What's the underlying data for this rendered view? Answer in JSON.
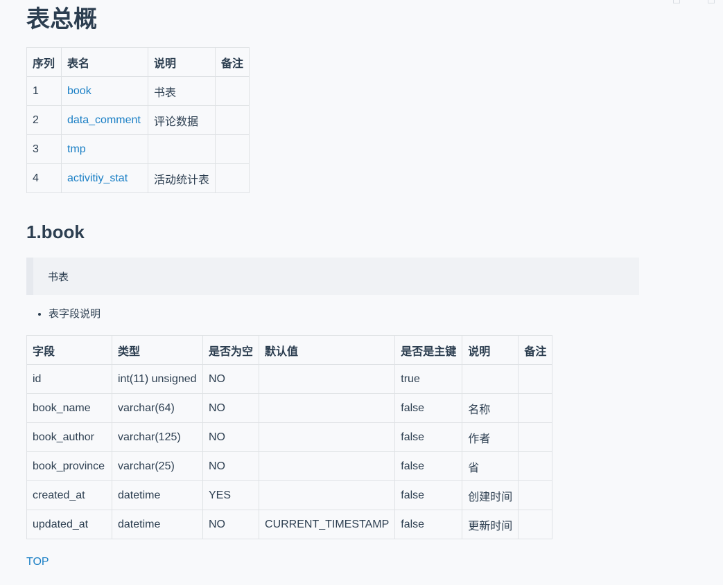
{
  "page_title": "表总概",
  "overview": {
    "headers": [
      "序列",
      "表名",
      "说明",
      "备注"
    ],
    "rows": [
      {
        "seq": "1",
        "name": "book",
        "desc": "书表",
        "note": ""
      },
      {
        "seq": "2",
        "name": "data_comment",
        "desc": "评论数据",
        "note": ""
      },
      {
        "seq": "3",
        "name": "tmp",
        "desc": "",
        "note": ""
      },
      {
        "seq": "4",
        "name": "activitiy_stat",
        "desc": "活动统计表",
        "note": ""
      }
    ]
  },
  "section": {
    "title": "1.book",
    "quote": "书表",
    "bullet": "表字段说明"
  },
  "fields": {
    "headers": [
      "字段",
      "类型",
      "是否为空",
      "默认值",
      "是否是主键",
      "说明",
      "备注"
    ],
    "rows": [
      [
        "id",
        "int(11) unsigned",
        "NO",
        "",
        "true",
        "",
        ""
      ],
      [
        "book_name",
        "varchar(64)",
        "NO",
        "",
        "false",
        "名称",
        ""
      ],
      [
        "book_author",
        "varchar(125)",
        "NO",
        "",
        "false",
        "作者",
        ""
      ],
      [
        "book_province",
        "varchar(25)",
        "NO",
        "",
        "false",
        "省",
        ""
      ],
      [
        "created_at",
        "datetime",
        "YES",
        "",
        "false",
        "创建时间",
        ""
      ],
      [
        "updated_at",
        "datetime",
        "NO",
        "CURRENT_TIMESTAMP",
        "false",
        "更新时间",
        ""
      ]
    ]
  },
  "top_link": "TOP",
  "colors": {
    "link": "#1a7fc5",
    "text": "#2c3e50",
    "border": "#dfe2e5",
    "background": "#f8f9fb",
    "quote_background": "#f0f2f5"
  }
}
